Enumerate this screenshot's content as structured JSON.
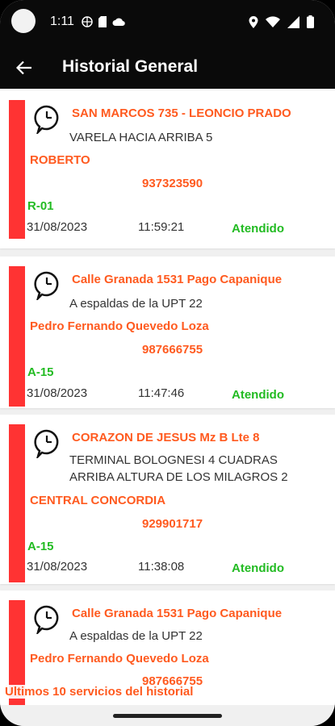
{
  "status_bar": {
    "time": "1:11"
  },
  "app_bar": {
    "title": "Historial General"
  },
  "services": [
    {
      "address": "SAN MARCOS 735 - LEONCIO PRADO",
      "reference": "VARELA HACIA ARRIBA 5",
      "client": "ROBERTO",
      "phone": "937323590",
      "unit": "R-01",
      "date": "31/08/2023",
      "time": "11:59:21",
      "status": "Atendido"
    },
    {
      "address": "Calle Granada 1531 Pago Capanique",
      "reference": "A espaldas de la UPT 22",
      "client": "Pedro Fernando Quevedo Loza",
      "phone": "987666755",
      "unit": "A-15",
      "date": "31/08/2023",
      "time": "11:47:46",
      "status": "Atendido"
    },
    {
      "address": "CORAZON DE JESUS Mz B Lte 8",
      "reference": "TERMINAL BOLOGNESI 4 CUADRAS\nARRIBA ALTURA DE LOS MILAGROS 2",
      "client": "CENTRAL CONCORDIA",
      "phone": "929901717",
      "unit": "A-15",
      "date": "31/08/2023",
      "time": "11:38:08",
      "status": "Atendido"
    },
    {
      "address": "Calle Granada 1531 Pago Capanique",
      "reference": "A espaldas de la UPT 22",
      "client": "Pedro Fernando Quevedo Loza",
      "phone": "987666755"
    }
  ],
  "footer": {
    "label": "Ultimos 10 servicios del historial"
  },
  "colors": {
    "accent": "#ff5a1f",
    "status_green": "#22bb22",
    "indicator_red": "#ff3333",
    "app_bar": "#0a0a0a"
  },
  "icons": {
    "back": "arrow-left-icon",
    "service": "clock-bubble-icon"
  }
}
